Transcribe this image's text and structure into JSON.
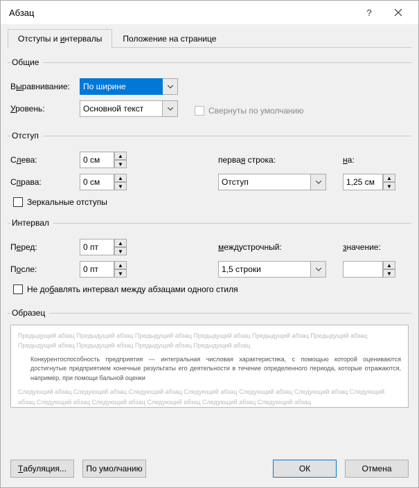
{
  "title": "Абзац",
  "tabs": {
    "indents": "Отступы и интервалы",
    "position": "Положение на странице"
  },
  "general": {
    "legend": "Общие",
    "alignment_label": "Выравнивание:",
    "alignment_value": "По ширине",
    "level_label": "Уровень:",
    "level_value": "Основной текст",
    "collapsed_label": "Свернуты по умолчанию"
  },
  "indent": {
    "legend": "Отступ",
    "left_label": "Слева:",
    "left_value": "0 см",
    "right_label": "Справа:",
    "right_value": "0 см",
    "first_line_label": "первая строка:",
    "first_line_value": "Отступ",
    "by_label": "на:",
    "by_value": "1,25 см",
    "mirror_label": "Зеркальные отступы"
  },
  "spacing": {
    "legend": "Интервал",
    "before_label": "Перед:",
    "before_value": "0 пт",
    "after_label": "После:",
    "after_value": "0 пт",
    "line_label": "междустрочный:",
    "line_value": "1,5 строки",
    "at_label": "значение:",
    "at_value": "",
    "no_add_label": "Не добавлять интервал между абзацами одного стиля"
  },
  "preview": {
    "legend": "Образец",
    "prev_text": "Предыдущий абзац Предыдущий абзац Предыдущий абзац Предыдущий абзац Предыдущий абзац Предыдущий абзац Предыдущий абзац Предыдущий абзац Предыдущий абзац Предыдущий абзац",
    "sample_text": "Конкурентоспособность предприятия — интегральная числовая характеристика, с помощью которой оцениваются достигнутые предприятием конечные результаты его деятельности в течение определенного периода, которые отражаются, например, при помощи бальной оценки",
    "next_text": "Следующий абзац Следующий абзац Следующий абзац Следующий абзац Следующий абзац Следующий абзац Следующий абзац Следующий абзац Следующий абзац Следующий абзац Следующий абзац Следующий абзац"
  },
  "buttons": {
    "tabs": "Табуляция...",
    "default": "По умолчанию",
    "ok": "ОК",
    "cancel": "Отмена"
  }
}
